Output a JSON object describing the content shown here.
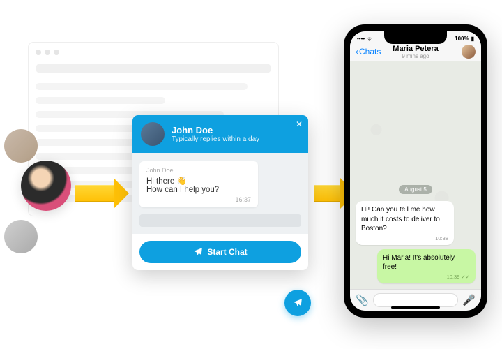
{
  "widget": {
    "name": "John Doe",
    "reply_time": "Typically replies within a day",
    "msg_from": "John Doe",
    "msg_line1": "Hi there 👋",
    "msg_line2": "How can I help you?",
    "msg_time": "16:37",
    "start_btn": "Start Chat"
  },
  "phone": {
    "status_left": "••••",
    "status_wifi": "⬨",
    "status_pct": "100%",
    "back": "Chats",
    "title": "Maria Petera",
    "subtitle": "9 mins ago",
    "date": "August 5",
    "msg_in": "Hi! Can you tell me how much it costs to deliver to Boston?",
    "msg_in_time": "10:38",
    "msg_out": "Hi Maria! It's absolutely free!",
    "msg_out_time": "10:39 ✓✓"
  }
}
